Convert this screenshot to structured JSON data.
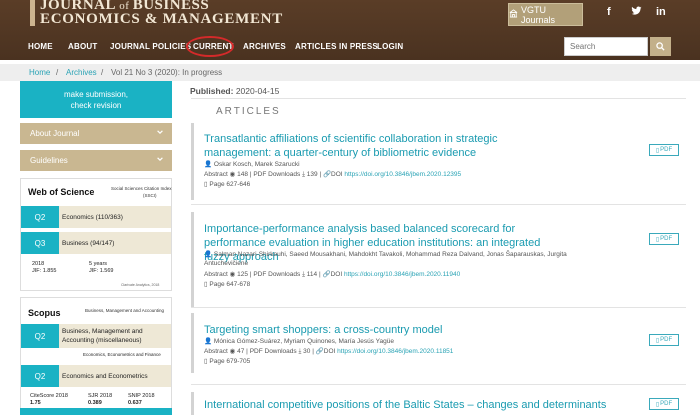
{
  "header": {
    "logo_line1_a": "JOURNAL",
    "logo_line1_of": " of ",
    "logo_line1_b": "BUSINESS",
    "logo_line2": "ECONOMICS & MANAGEMENT",
    "vgtu_label": "VGTU Journals",
    "social": [
      "f",
      "t",
      "in"
    ]
  },
  "nav": {
    "items": [
      "HOME",
      "ABOUT",
      "JOURNAL POLICIES",
      "CURRENT",
      "ARCHIVES",
      "ARTICLES IN PRESS",
      "LOGIN"
    ],
    "highlight_color": "#d42a2a"
  },
  "search": {
    "placeholder": "Search"
  },
  "breadcrumb": {
    "home": "Home",
    "sep": "/",
    "archives": "Archives",
    "current": "Vol 21 No 3 (2020): In progress"
  },
  "sidebar": {
    "submit_line1": "make submission,",
    "submit_line2": "check revision",
    "accordion": [
      "About Journal",
      "Guidelines"
    ],
    "wos": {
      "title": "Web of Science",
      "subtitle": "Social Sciences Citation Index",
      "subtitle2": "(SSCI)",
      "rows": [
        {
          "quartile": "Q2",
          "label": "Economics (110/363)"
        },
        {
          "quartile": "Q3",
          "label": "Business (94/147)"
        }
      ],
      "jif_year": "2018",
      "jif": "JIF: 1.855",
      "jif5_year": "5 years",
      "jif5": "JIF: 1.569",
      "source": "Clarivate Analytics, 2018"
    },
    "scopus": {
      "title": "Scopus",
      "subtitle": "Business, Management and Accounting",
      "rows": [
        {
          "quartile": "Q2",
          "label_line1": "Business, Management and",
          "label_line2": "Accounting (miscellaneous)"
        },
        {
          "quartile": "Q2",
          "label_line1": "Economics and Econometrics"
        }
      ],
      "category": "Economics, Econometrics and Finance",
      "metrics": [
        {
          "name": "CiteScore 2018",
          "value": "1.75"
        },
        {
          "name": "SJR 2018",
          "value": "0.389"
        },
        {
          "name": "SNIP 2018",
          "value": "0.637"
        }
      ]
    }
  },
  "main": {
    "published_label": "Published:",
    "published_date": " 2020-04-15",
    "section_title": "ARTICLES",
    "pdf_label": "PDF",
    "articles": [
      {
        "title": "Transatlantic affiliations of scientific collaboration in strategic management: a quarter-century of bibliometric evidence",
        "authors": "Oskar Kosch, Marek Szarucki",
        "abstract": "Abstract",
        "views": "148",
        "pdf_downloads": "PDF Downloads",
        "downloads": "139",
        "doi_label": "DOI",
        "doi": "https://doi.org/10.3846/jbem.2020.12395",
        "pages": "Page 627-646"
      },
      {
        "title": "Importance-performance analysis based balanced scorecard for performance evaluation in higher education institutions: an integrated fuzzy approach",
        "authors": "Salman Nazari-Shirkouhi, Saeed Mousakhani, Mahdokht Tavakoli, Mohammad Reza Dalvand, Jonas Šaparauskas, Jurgita Antuchevičienė",
        "abstract": "Abstract",
        "views": "125",
        "pdf_downloads": "PDF Downloads",
        "downloads": "114",
        "doi_label": "DOI",
        "doi": "https://doi.org/10.3846/jbem.2020.11940",
        "pages": "Page 647-678"
      },
      {
        "title": "Targeting smart shoppers: a cross-country model",
        "authors": "Mónica Gómez-Suárez, Myriam Quinones, María Jesús Yagüe",
        "abstract": "Abstract",
        "views": "47",
        "pdf_downloads": "PDF Downloads",
        "downloads": "30",
        "doi_label": "DOI",
        "doi": "https://doi.org/10.3846/jbem.2020.11851",
        "pages": "Page 679-705"
      },
      {
        "title": "International competitive positions of the Baltic States – changes and determinants"
      }
    ]
  }
}
